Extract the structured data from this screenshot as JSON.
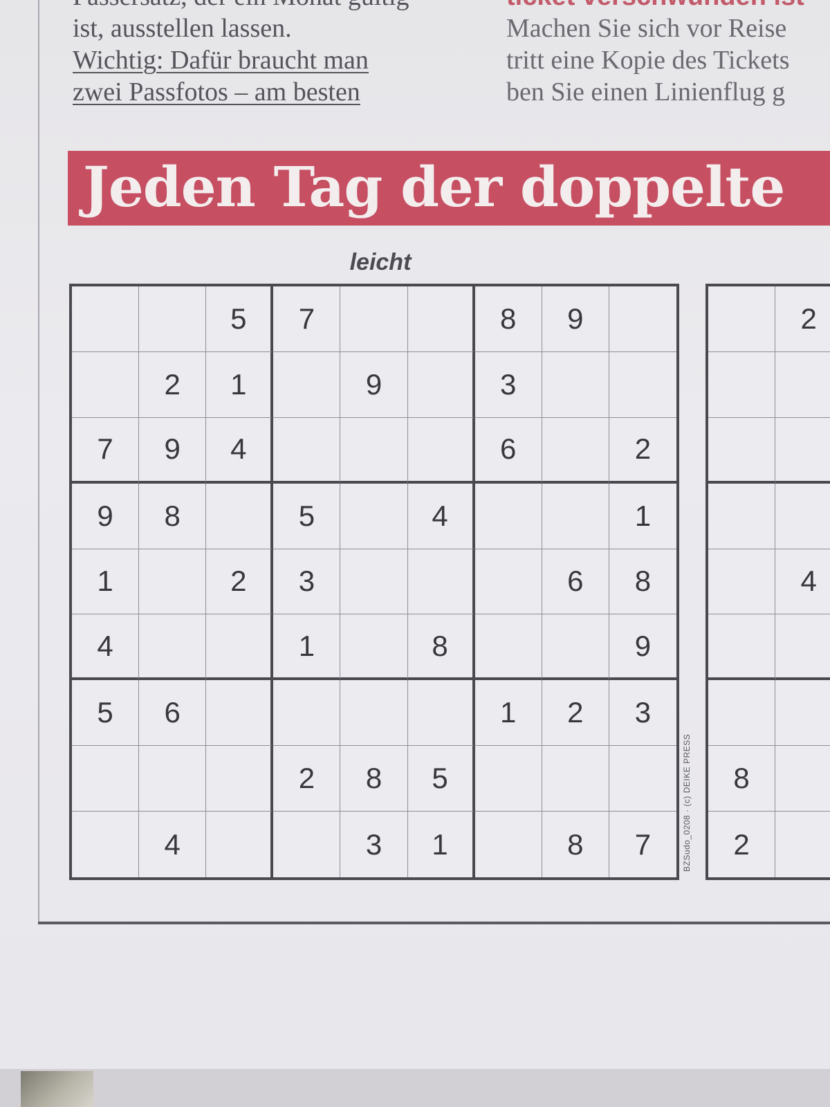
{
  "article": {
    "left_lines": [
      "Passersatz, der ein Monat gültig",
      "ist, ausstellen lassen.",
      "Wichtig: Dafür braucht man",
      "zwei Passfotos – am besten"
    ],
    "right_lines": [
      "ticket verschwunden ist",
      "Machen Sie sich vor Reise",
      "tritt eine Kopie des Tickets",
      "ben Sie einen Linienflug g"
    ]
  },
  "headline": "Jeden Tag der doppelte",
  "puzzle": {
    "difficulty": "leicht",
    "credit": "BZSudo_0208 · (c) DEIKE PRESS",
    "main_grid": [
      [
        "",
        "",
        "5",
        "7",
        "",
        "",
        "8",
        "9",
        ""
      ],
      [
        "",
        "2",
        "1",
        "",
        "9",
        "",
        "3",
        "",
        ""
      ],
      [
        "7",
        "9",
        "4",
        "",
        "",
        "",
        "6",
        "",
        "2"
      ],
      [
        "9",
        "8",
        "",
        "5",
        "",
        "4",
        "",
        "",
        "1"
      ],
      [
        "1",
        "",
        "2",
        "3",
        "",
        "",
        "",
        "6",
        "8"
      ],
      [
        "4",
        "",
        "",
        "1",
        "",
        "8",
        "",
        "",
        "9"
      ],
      [
        "5",
        "6",
        "",
        "",
        "",
        "",
        "1",
        "2",
        "3"
      ],
      [
        "",
        "",
        "",
        "2",
        "8",
        "5",
        "",
        "",
        ""
      ],
      [
        "",
        "4",
        "",
        "",
        "3",
        "1",
        "",
        "8",
        "7"
      ]
    ],
    "second_grid_visible": [
      [
        "",
        "2"
      ],
      [
        "",
        ""
      ],
      [
        "",
        ""
      ],
      [
        "",
        ""
      ],
      [
        "",
        "4"
      ],
      [
        "",
        ""
      ],
      [
        "",
        ""
      ],
      [
        "8",
        ""
      ],
      [
        "2",
        ""
      ]
    ]
  }
}
